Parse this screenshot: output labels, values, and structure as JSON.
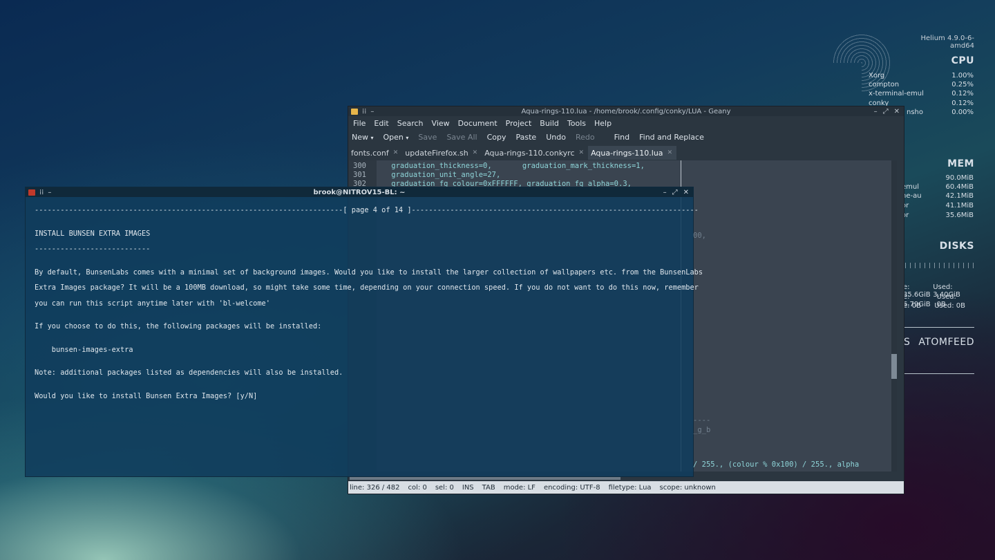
{
  "conky": {
    "kernel": "Helium  4.9.0-6-amd64",
    "cpu": {
      "title": "CPU",
      "processes": [
        {
          "name": "Xorg",
          "value": "1.00%"
        },
        {
          "name": "compton",
          "value": "0.25%"
        },
        {
          "name": "x-terminal-emul",
          "value": "0.12%"
        },
        {
          "name": "conky",
          "value": "0.12%"
        },
        {
          "name": "nsho",
          "value": "0.00%"
        }
      ]
    },
    "mem": {
      "title": "MEM",
      "processes": [
        {
          "name": "",
          "value": "90.0MiB"
        },
        {
          "name": "emul",
          "value": "60.4MiB"
        },
        {
          "name": "ne-au",
          "value": "42.1MiB"
        },
        {
          "name": "or",
          "value": "41.1MiB"
        },
        {
          "name": "or",
          "value": "35.6MiB"
        }
      ]
    },
    "disks": {
      "title": "DISKS",
      "rows": [
        {
          "a": "e: 35.6GiB",
          "b": "Used: 3.40GiB"
        },
        {
          "a": "e: 6.79GiB",
          "b": "Used: 0B"
        },
        {
          "a": "e: 0B",
          "b": "Used: 0B"
        }
      ]
    },
    "feeds": {
      "left": "S",
      "title": "ATOMFEED"
    }
  },
  "geany": {
    "title": "Aqua-rings-110.lua - /home/brook/.config/conky/LUA - Geany",
    "menu": [
      "File",
      "Edit",
      "Search",
      "View",
      "Document",
      "Project",
      "Build",
      "Tools",
      "Help"
    ],
    "toolbar": {
      "new": "New",
      "open": "Open",
      "save": "Save",
      "save_all": "Save All",
      "copy": "Copy",
      "paste": "Paste",
      "undo": "Undo",
      "redo": "Redo",
      "find": "Find",
      "find_replace": "Find and Replace"
    },
    "tabs": [
      {
        "label": "fonts.conf"
      },
      {
        "label": "updateFirefox.sh"
      },
      {
        "label": "Aqua-rings-110.conkyrc"
      },
      {
        "label": "Aqua-rings-110.lua"
      }
    ],
    "code_lines": [
      {
        "num": "300",
        "text": "    graduation_thickness=0,       graduation_mark_thickness=1,"
      },
      {
        "num": "301",
        "text": "    graduation_unit_angle=27,"
      },
      {
        "num": "302",
        "text": "    graduation_fg_colour=0xFFFFFF, graduation_fg_alpha=0.3,"
      }
    ],
    "overflow_text": {
      "line1": "00,",
      "line2": "----",
      "line3": "_g_b",
      "line4": "/ 255., (colour % 0x100) / 255., alpha"
    },
    "status": {
      "line": "line: 326 / 482",
      "col": "col: 0",
      "sel": "sel: 0",
      "ins": "INS",
      "tab": "TAB",
      "mode": "mode: LF",
      "encoding": "encoding: UTF-8",
      "filetype": "filetype: Lua",
      "scope": "scope: unknown"
    }
  },
  "terminal": {
    "title": "brook@NITROV15-BL: ~",
    "lines": [
      "------------------------------------------------------------------------[ page 4 of 14 ]-------------------------------------------------------------------",
      "",
      "INSTALL BUNSEN EXTRA IMAGES",
      "---------------------------",
      "",
      "By default, BunsenLabs comes with a minimal set of background images. Would you like to install the larger collection of wallpapers etc. from the BunsenLabs",
      "Extra Images package? It will be a 100MB download, so might take some time, depending on your connection speed. If you do not want to do this now, remember",
      "you can run this script anytime later with 'bl-welcome'",
      "",
      "If you choose to do this, the following packages will be installed:",
      "",
      "    bunsen-images-extra",
      "",
      "Note: additional packages listed as dependencies will also be installed.",
      "",
      "Would you like to install Bunsen Extra Images? [y/N]"
    ]
  }
}
